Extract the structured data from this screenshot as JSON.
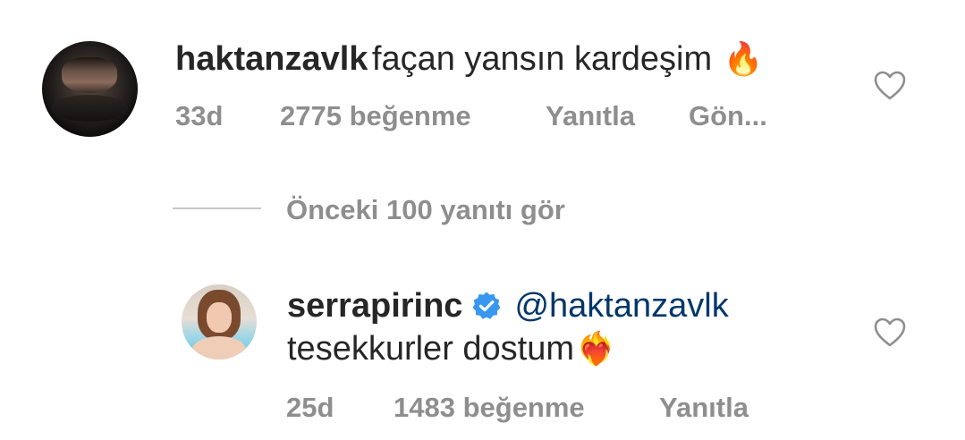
{
  "comments": [
    {
      "username": "haktanzavlk",
      "text": "façan yansın kardeşim",
      "emoji": "🔥",
      "time": "33d",
      "likes": "2775 beğenme",
      "reply": "Yanıtla",
      "more": "Gön..."
    }
  ],
  "replies_toggle": {
    "label": "Önceki 100 yanıtı gör"
  },
  "replies": [
    {
      "username": "serrapirinc",
      "verified": true,
      "mention": "@haktanzavlk",
      "text": "tesekkurler dostum",
      "emoji": "❤️‍🔥",
      "time": "25d",
      "likes": "1483 beğenme",
      "reply": "Yanıtla"
    }
  ],
  "icons": {
    "like": "heart-outline-icon",
    "verified": "verified-badge-icon"
  },
  "colors": {
    "text_primary": "#262626",
    "text_secondary": "#8e8e8e",
    "mention": "#00376b",
    "verified": "#3897f0"
  }
}
